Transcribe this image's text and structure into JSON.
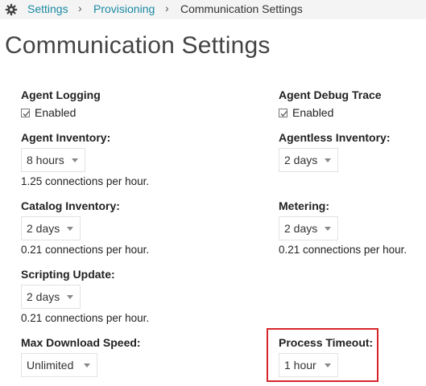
{
  "breadcrumb": {
    "items": [
      "Settings",
      "Provisioning"
    ],
    "separator": "›",
    "current": "Communication Settings"
  },
  "page": {
    "title": "Communication Settings"
  },
  "fields": {
    "agent_logging": {
      "label": "Agent Logging",
      "checkbox_label": "Enabled",
      "checked": true
    },
    "agent_debug_trace": {
      "label": "Agent Debug Trace",
      "checkbox_label": "Enabled",
      "checked": true
    },
    "agent_inventory": {
      "label": "Agent Inventory:",
      "value": "8 hours",
      "info": "1.25 connections per hour."
    },
    "agentless_inventory": {
      "label": "Agentless Inventory:",
      "value": "2 days"
    },
    "catalog_inventory": {
      "label": "Catalog Inventory:",
      "value": "2 days",
      "info": "0.21 connections per hour."
    },
    "metering": {
      "label": "Metering:",
      "value": "2 days",
      "info": "0.21 connections per hour."
    },
    "scripting_update": {
      "label": "Scripting Update:",
      "value": "2 days",
      "info": "0.21 connections per hour."
    },
    "max_download_speed": {
      "label": "Max Download Speed:",
      "value": "Unlimited"
    },
    "process_timeout": {
      "label": "Process Timeout:",
      "value": "1 hour",
      "highlighted": true
    }
  },
  "colors": {
    "link": "#1a8aa3",
    "highlight": "#d6262c"
  },
  "icons": {
    "breadcrumb_root": "gear-icon",
    "select_caret": "caret-down-icon",
    "checkbox": "checkmark-icon"
  }
}
